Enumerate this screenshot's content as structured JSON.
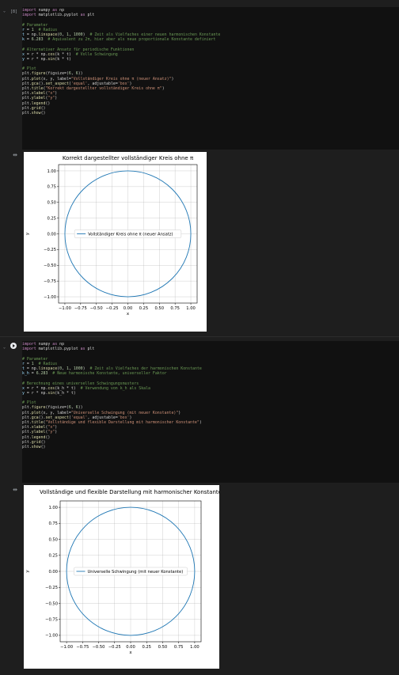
{
  "cells": [
    {
      "exec_count": "[8]",
      "code_lines": [
        [
          [
            "kw",
            "import"
          ],
          [
            "t",
            " numpy "
          ],
          [
            "kw",
            "as"
          ],
          [
            "t",
            " np"
          ]
        ],
        [
          [
            "kw",
            "import"
          ],
          [
            "t",
            " matplotlib.pyplot "
          ],
          [
            "kw",
            "as"
          ],
          [
            "t",
            " plt"
          ]
        ],
        [],
        [
          [
            "com",
            "# Parameter"
          ]
        ],
        [
          [
            "var",
            "r"
          ],
          [
            "t",
            " = "
          ],
          [
            "num",
            "1"
          ],
          [
            "com",
            "  # Radius"
          ]
        ],
        [
          [
            "var",
            "t"
          ],
          [
            "t",
            " = np."
          ],
          [
            "fn",
            "linspace"
          ],
          [
            "t",
            "("
          ],
          [
            "num",
            "0"
          ],
          [
            "t",
            ", "
          ],
          [
            "num",
            "1"
          ],
          [
            "t",
            ", "
          ],
          [
            "num",
            "1000"
          ],
          [
            "t",
            ")  "
          ],
          [
            "com",
            "# Zeit als Vielfaches einer neuen harmonischen Konstante"
          ]
        ],
        [
          [
            "var",
            "k"
          ],
          [
            "t",
            " = "
          ],
          [
            "num",
            "6.283"
          ],
          [
            "com",
            "  # Äquivalent zu 2π, hier aber als neue proportionale Konstante definiert"
          ]
        ],
        [],
        [
          [
            "com",
            "# Alternativer Ansatz für periodische Funktionen"
          ]
        ],
        [
          [
            "var",
            "x"
          ],
          [
            "t",
            " = r * np."
          ],
          [
            "fn",
            "cos"
          ],
          [
            "t",
            "(k * t)  "
          ],
          [
            "com",
            "# Volle Schwingung"
          ]
        ],
        [
          [
            "var",
            "y"
          ],
          [
            "t",
            " = r * np."
          ],
          [
            "fn",
            "sin"
          ],
          [
            "t",
            "(k * t)"
          ]
        ],
        [],
        [
          [
            "com",
            "# Plot"
          ]
        ],
        [
          [
            "t",
            "plt."
          ],
          [
            "fn",
            "figure"
          ],
          [
            "t",
            "(figsize=("
          ],
          [
            "num",
            "6"
          ],
          [
            "t",
            ", "
          ],
          [
            "num",
            "6"
          ],
          [
            "t",
            "))"
          ]
        ],
        [
          [
            "t",
            "plt."
          ],
          [
            "fn",
            "plot"
          ],
          [
            "t",
            "(x, y, label="
          ],
          [
            "str",
            "\"Vollständiger Kreis ohne π (neuer Ansatz)\""
          ],
          [
            "t",
            ")"
          ]
        ],
        [
          [
            "t",
            "plt."
          ],
          [
            "fn",
            "gca"
          ],
          [
            "t",
            "()."
          ],
          [
            "fn",
            "set_aspect"
          ],
          [
            "t",
            "("
          ],
          [
            "str",
            "'equal'"
          ],
          [
            "t",
            ", adjustable="
          ],
          [
            "str",
            "'box'"
          ],
          [
            "t",
            ")"
          ]
        ],
        [
          [
            "t",
            "plt."
          ],
          [
            "fn",
            "title"
          ],
          [
            "t",
            "("
          ],
          [
            "str",
            "\"Korrekt dargestellter vollständiger Kreis ohne π\""
          ],
          [
            "t",
            ")"
          ]
        ],
        [
          [
            "t",
            "plt."
          ],
          [
            "fn",
            "xlabel"
          ],
          [
            "t",
            "("
          ],
          [
            "str",
            "\"x\""
          ],
          [
            "t",
            ")"
          ]
        ],
        [
          [
            "t",
            "plt."
          ],
          [
            "fn",
            "ylabel"
          ],
          [
            "t",
            "("
          ],
          [
            "str",
            "\"y\""
          ],
          [
            "t",
            ")"
          ]
        ],
        [
          [
            "t",
            "plt."
          ],
          [
            "fn",
            "legend"
          ],
          [
            "t",
            "()"
          ]
        ],
        [
          [
            "t",
            "plt."
          ],
          [
            "fn",
            "grid"
          ],
          [
            "t",
            "()"
          ]
        ],
        [
          [
            "t",
            "plt."
          ],
          [
            "fn",
            "show"
          ],
          [
            "t",
            "()"
          ]
        ]
      ]
    },
    {
      "exec_count": "",
      "code_lines": [
        [
          [
            "kw",
            "import"
          ],
          [
            "t",
            " numpy "
          ],
          [
            "kw",
            "as"
          ],
          [
            "t",
            " np"
          ]
        ],
        [
          [
            "kw",
            "import"
          ],
          [
            "t",
            " matplotlib.pyplot "
          ],
          [
            "kw",
            "as"
          ],
          [
            "t",
            " plt"
          ]
        ],
        [],
        [
          [
            "com",
            "# Parameter"
          ]
        ],
        [
          [
            "var",
            "r"
          ],
          [
            "t",
            " = "
          ],
          [
            "num",
            "1"
          ],
          [
            "com",
            "  # Radius"
          ]
        ],
        [
          [
            "var",
            "t"
          ],
          [
            "t",
            " = np."
          ],
          [
            "fn",
            "linspace"
          ],
          [
            "t",
            "("
          ],
          [
            "num",
            "0"
          ],
          [
            "t",
            ", "
          ],
          [
            "num",
            "1"
          ],
          [
            "t",
            ", "
          ],
          [
            "num",
            "1000"
          ],
          [
            "t",
            ")  "
          ],
          [
            "com",
            "# Zeit als Vielfaches der harmonischen Konstante"
          ]
        ],
        [
          [
            "var",
            "k_h"
          ],
          [
            "t",
            " = "
          ],
          [
            "num",
            "6.283"
          ],
          [
            "com",
            "  # Neue harmonische Konstante, universeller Faktor"
          ]
        ],
        [],
        [
          [
            "com",
            "# Berechnung eines universellen Schwingungsmusters"
          ]
        ],
        [
          [
            "var",
            "x"
          ],
          [
            "t",
            " = r * np."
          ],
          [
            "fn",
            "cos"
          ],
          [
            "t",
            "(k_h * t)  "
          ],
          [
            "com",
            "# Verwendung von k_h als Skala"
          ]
        ],
        [
          [
            "var",
            "y"
          ],
          [
            "t",
            " = r * np."
          ],
          [
            "fn",
            "sin"
          ],
          [
            "t",
            "(k_h * t)"
          ]
        ],
        [],
        [
          [
            "com",
            "# Plot"
          ]
        ],
        [
          [
            "t",
            "plt."
          ],
          [
            "fn",
            "figure"
          ],
          [
            "t",
            "(figsize=("
          ],
          [
            "num",
            "6"
          ],
          [
            "t",
            ", "
          ],
          [
            "num",
            "6"
          ],
          [
            "t",
            "))"
          ]
        ],
        [
          [
            "t",
            "plt."
          ],
          [
            "fn",
            "plot"
          ],
          [
            "t",
            "(x, y, label="
          ],
          [
            "str",
            "\"Universelle Schwingung (mit neuer Konstante)\""
          ],
          [
            "t",
            ")"
          ]
        ],
        [
          [
            "t",
            "plt."
          ],
          [
            "fn",
            "gca"
          ],
          [
            "t",
            "()."
          ],
          [
            "fn",
            "set_aspect"
          ],
          [
            "t",
            "("
          ],
          [
            "str",
            "'equal'"
          ],
          [
            "t",
            ", adjustable="
          ],
          [
            "str",
            "'box'"
          ],
          [
            "t",
            ")"
          ]
        ],
        [
          [
            "t",
            "plt."
          ],
          [
            "fn",
            "title"
          ],
          [
            "t",
            "("
          ],
          [
            "str",
            "\"Vollständige und flexible Darstellung mit harmonischer Konstante\""
          ],
          [
            "t",
            ")"
          ]
        ],
        [
          [
            "t",
            "plt."
          ],
          [
            "fn",
            "xlabel"
          ],
          [
            "t",
            "("
          ],
          [
            "str",
            "\"x\""
          ],
          [
            "t",
            ")"
          ]
        ],
        [
          [
            "t",
            "plt."
          ],
          [
            "fn",
            "ylabel"
          ],
          [
            "t",
            "("
          ],
          [
            "str",
            "\"y\""
          ],
          [
            "t",
            ")"
          ]
        ],
        [
          [
            "t",
            "plt."
          ],
          [
            "fn",
            "legend"
          ],
          [
            "t",
            "()"
          ]
        ],
        [
          [
            "t",
            "plt."
          ],
          [
            "fn",
            "grid"
          ],
          [
            "t",
            "()"
          ]
        ],
        [
          [
            "t",
            "plt."
          ],
          [
            "fn",
            "show"
          ],
          [
            "t",
            "()"
          ]
        ]
      ]
    }
  ],
  "chart_data": [
    {
      "type": "line",
      "title": "Korrekt dargestellter vollständiger Kreis ohne π",
      "xlabel": "x",
      "ylabel": "y",
      "xlim": [
        -1.1,
        1.1
      ],
      "ylim": [
        -1.1,
        1.1
      ],
      "xticks": [
        -1.0,
        -0.75,
        -0.5,
        -0.25,
        0.0,
        0.25,
        0.5,
        0.75,
        1.0
      ],
      "xtick_labels": [
        "−1.00",
        "−0.75",
        "−0.50",
        "−0.25",
        "0.00",
        "0.25",
        "0.50",
        "0.75",
        "1.00"
      ],
      "yticks": [
        1.0,
        0.75,
        0.5,
        0.25,
        0.0,
        -0.25,
        -0.5,
        -0.75,
        -1.0
      ],
      "ytick_labels": [
        "1.00",
        "0.75",
        "0.50",
        "0.25",
        "0.00",
        "−0.25",
        "−0.50",
        "−0.75",
        "−1.00"
      ],
      "grid": true,
      "legend": "center",
      "series": [
        {
          "name": "Vollständiger Kreis ohne π (neuer Ansatz)",
          "shape": "circle",
          "center": [
            0,
            0
          ],
          "radius": 1,
          "color": "#1f77b4"
        }
      ]
    },
    {
      "type": "line",
      "title": "Vollständige und flexible Darstellung mit harmonischer Konstante",
      "xlabel": "x",
      "ylabel": "y",
      "xlim": [
        -1.1,
        1.1
      ],
      "ylim": [
        -1.1,
        1.1
      ],
      "xticks": [
        -1.0,
        -0.75,
        -0.5,
        -0.25,
        0.0,
        0.25,
        0.5,
        0.75,
        1.0
      ],
      "xtick_labels": [
        "−1.00",
        "−0.75",
        "−0.50",
        "−0.25",
        "0.00",
        "0.25",
        "0.50",
        "0.75",
        "1.00"
      ],
      "yticks": [
        1.0,
        0.75,
        0.5,
        0.25,
        0.0,
        -0.25,
        -0.5,
        -0.75,
        -1.0
      ],
      "ytick_labels": [
        "1.00",
        "0.75",
        "0.50",
        "0.25",
        "0.00",
        "−0.25",
        "−0.50",
        "−0.75",
        "−1.00"
      ],
      "grid": true,
      "legend": "center",
      "series": [
        {
          "name": "Universelle Schwingung (mit neuer Konstante)",
          "shape": "circle",
          "center": [
            0,
            0
          ],
          "radius": 1,
          "color": "#1f77b4"
        }
      ]
    }
  ]
}
